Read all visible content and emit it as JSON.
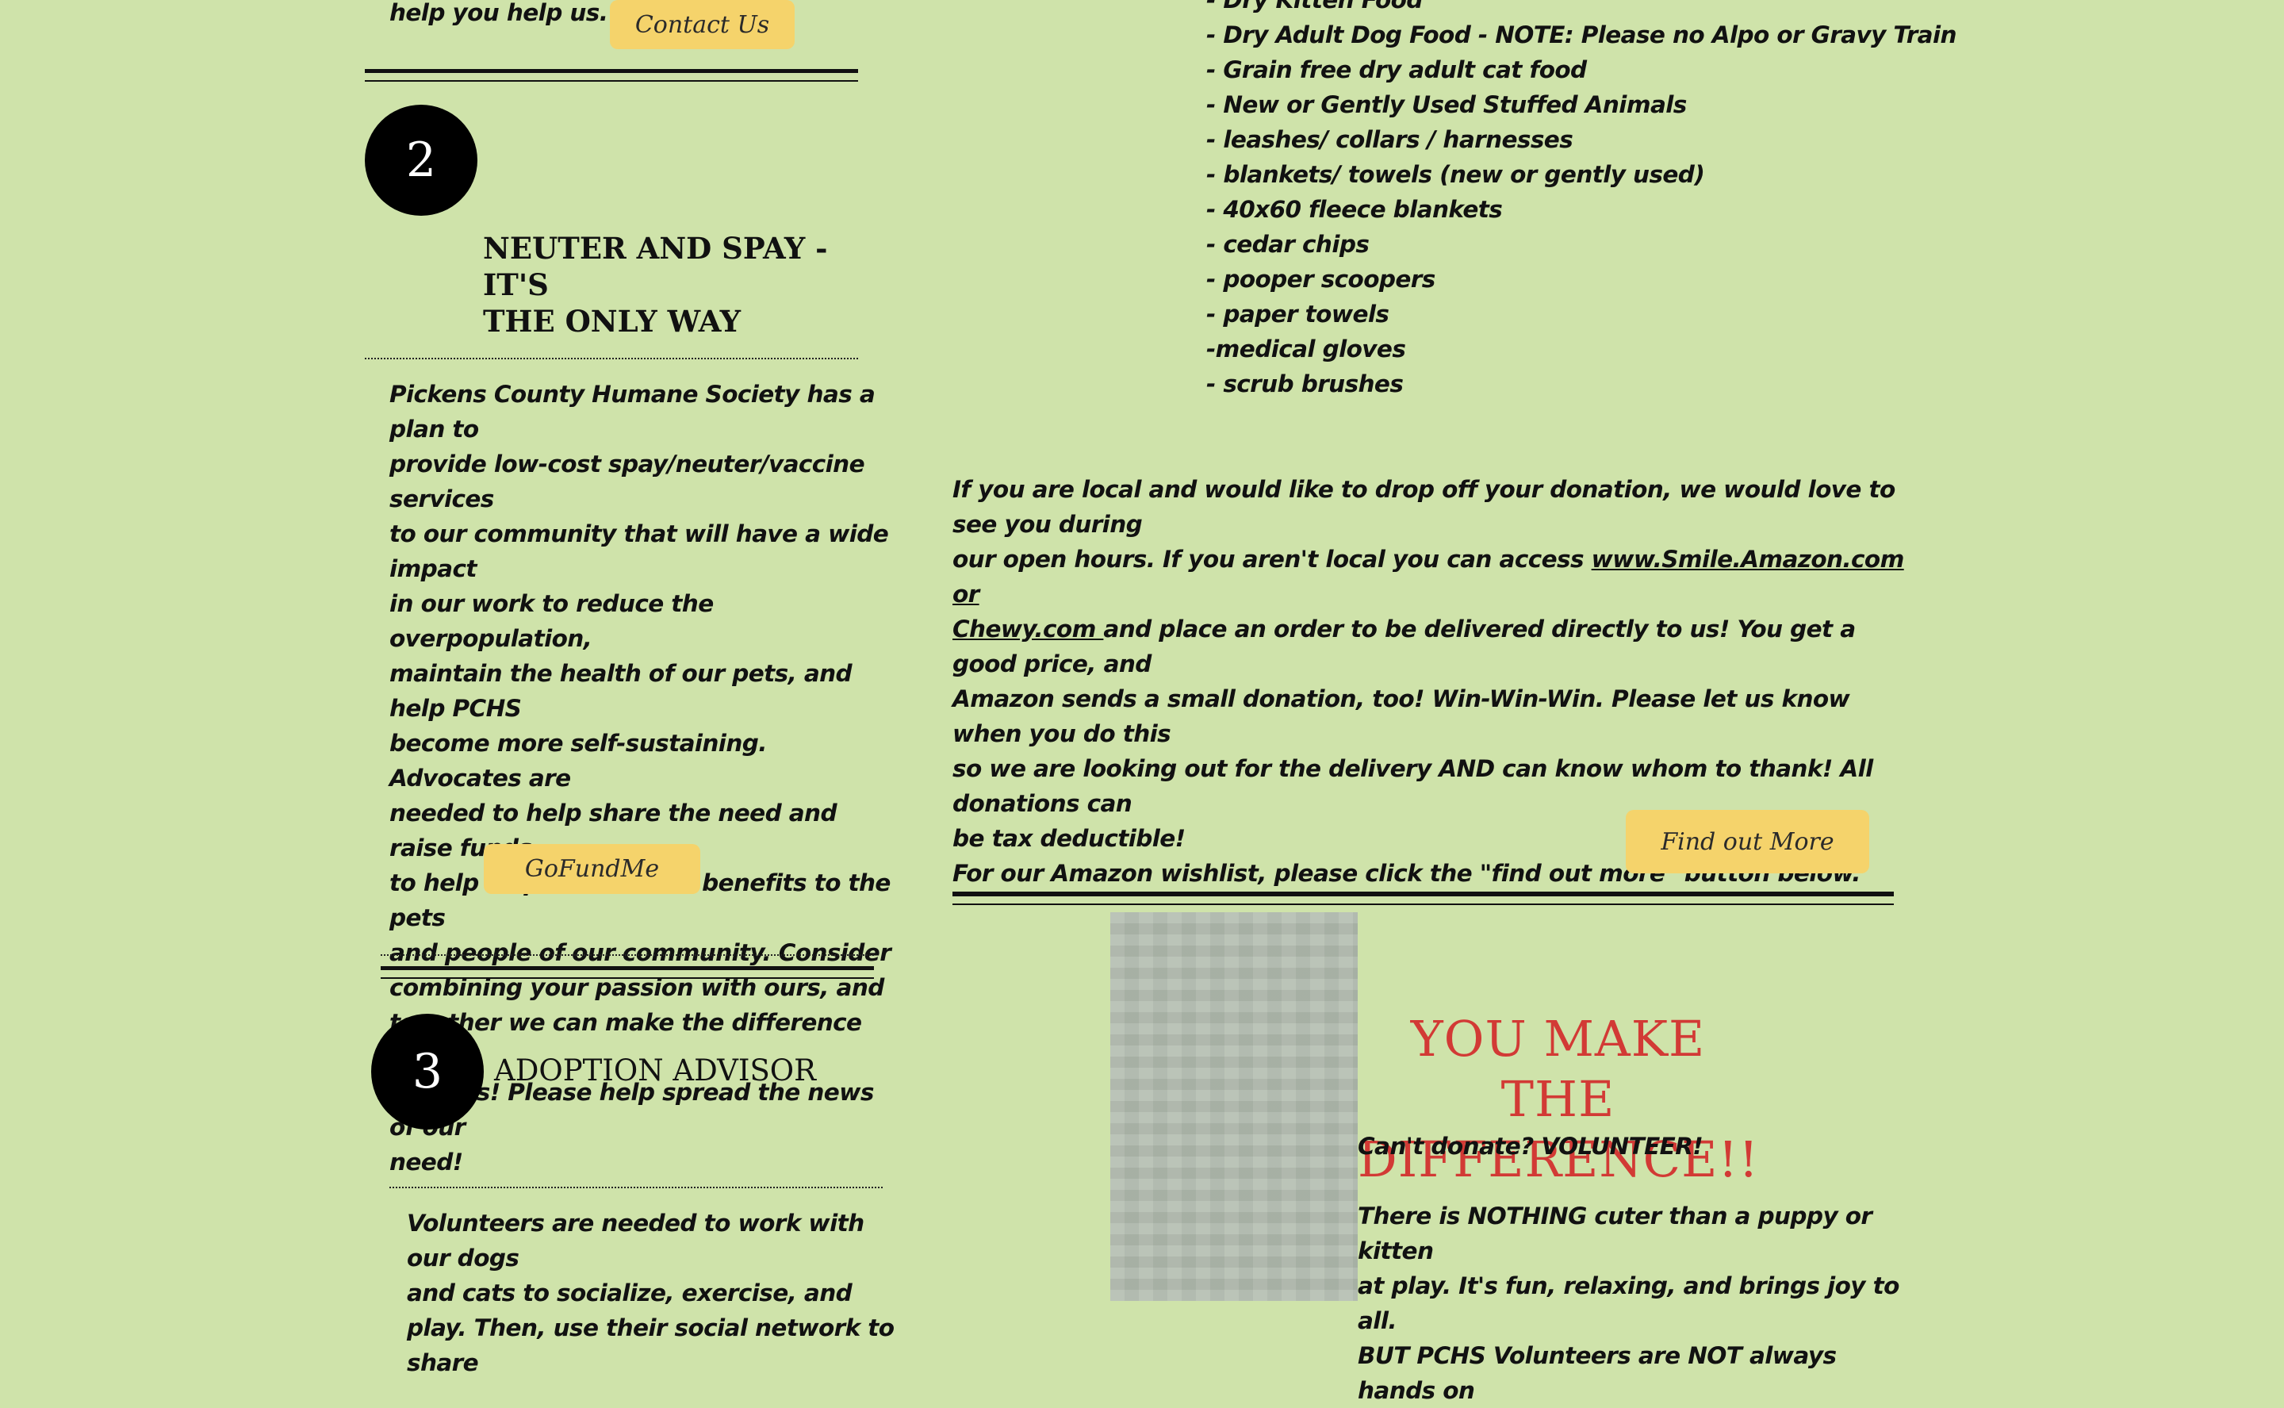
{
  "left": {
    "top_text": "help you help us.",
    "contact_button": "Contact Us",
    "section2": {
      "number": "2",
      "title_line1": "NEUTER AND SPAY - IT'S",
      "title_line2": "THE ONLY WAY",
      "paragraph": [
        "Pickens County Humane Society has a plan to",
        "provide low-cost spay/neuter/vaccine services",
        "to our community that will have a wide impact",
        "in our work to reduce the overpopulation,",
        "maintain the health of our pets, and help PCHS",
        "become more self-sustaining.  Advocates are",
        "needed to help share the need and raise funds",
        "to help us provide more benefits to the pets",
        "and people of our community.  Consider",
        "combining your passion with ours, and",
        "together we can make the difference that",
        "matters! Please help spread the news of our",
        "need!"
      ],
      "gofundme_button": "GoFundMe"
    },
    "section3": {
      "number": "3",
      "title": "ADOPTION ADVISOR",
      "paragraph": [
        "Volunteers are needed to work with our dogs",
        "and cats to socialize, exercise, and",
        "play. Then, use their social network to share"
      ]
    }
  },
  "right": {
    "donation_list": [
      "- Dry Kitten Food",
      "- Dry Adult Dog Food - NOTE: Please no Alpo or Gravy Train",
      "- Grain free dry adult cat food",
      "- New or Gently Used Stuffed Animals",
      "- leashes/ collars / harnesses",
      "- blankets/ towels (new or gently used)",
      "- 40x60 fleece blankets",
      "- cedar chips",
      "- pooper scoopers",
      "- paper towels",
      "-medical gloves",
      "- scrub brushes"
    ],
    "donate": {
      "line1": "If you are local and would like to drop off your donation, we would love to see you during",
      "line2_pre": "our open hours. If you aren't local you can access ",
      "link1": "www.Smile.Amazon.com or",
      "link2": "Chewy.com ",
      "line3_post": "and place an order to be delivered directly to us!  You get a good price, and",
      "line4": "Amazon sends a small donation, too! Win-Win-Win. Please let us know when you do this",
      "line5": "so we are looking out for the delivery AND can know whom to thank!  All donations can",
      "line6": "be tax deductible!",
      "line7": "For our Amazon wishlist, please click the \"find out more\" button below."
    },
    "find_more_button": "Find out More",
    "volunteer": {
      "headline_line1": "YOU MAKE THE",
      "headline_line2": "DIFFERENCE!!",
      "subhead": "Can't donate? VOLUNTEER!",
      "paragraph": [
        "There is NOTHING cuter than a puppy or kitten",
        "at play.  It's fun, relaxing, and brings joy to all.",
        "BUT PCHS Volunteers are NOT always hands on"
      ]
    }
  },
  "colors": {
    "background": "#cfe3aa",
    "button": "#f5d36b",
    "headline_red": "#d23a35"
  }
}
